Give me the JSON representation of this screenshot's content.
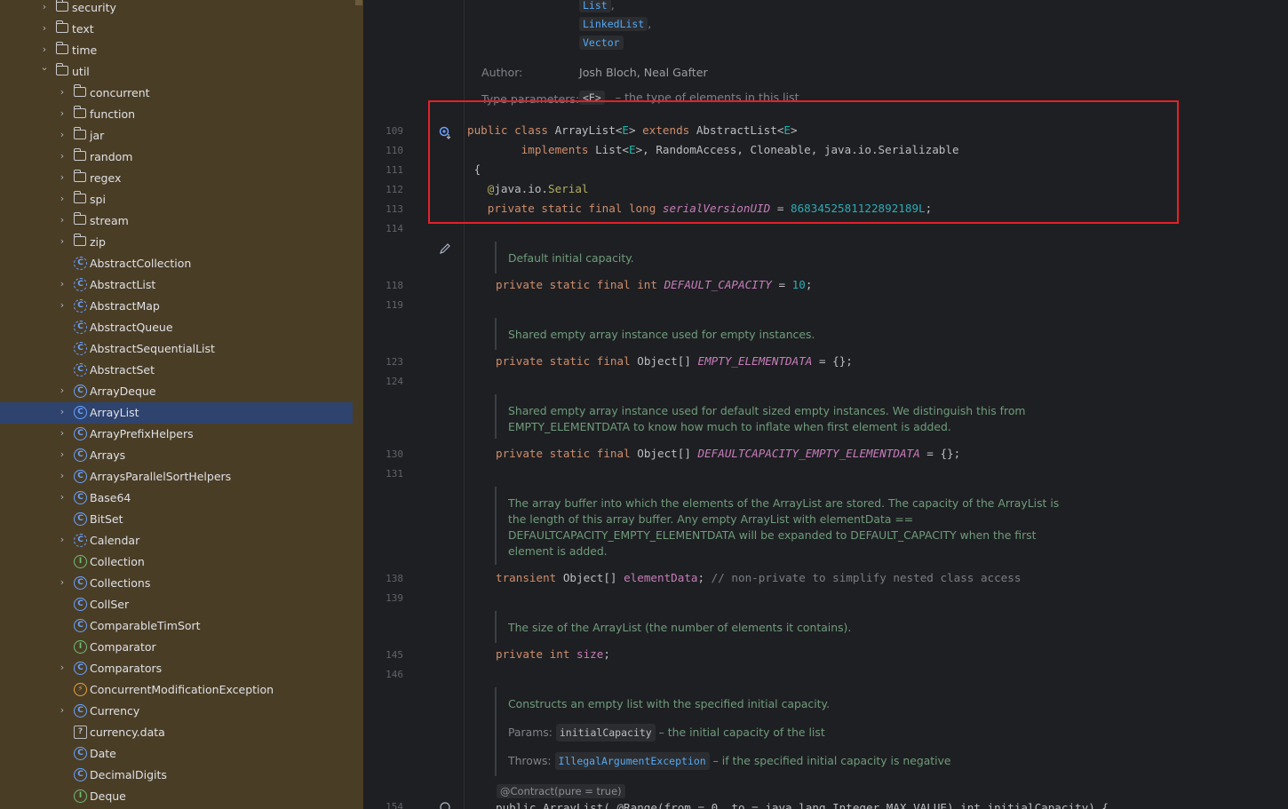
{
  "tree": {
    "items": [
      {
        "kind": "folder",
        "label": "security",
        "indent": 0,
        "expand": "right"
      },
      {
        "kind": "folder",
        "label": "text",
        "indent": 0,
        "expand": "right"
      },
      {
        "kind": "folder",
        "label": "time",
        "indent": 0,
        "expand": "right"
      },
      {
        "kind": "folder",
        "label": "util",
        "indent": 0,
        "expand": "down"
      },
      {
        "kind": "folder",
        "label": "concurrent",
        "indent": 1,
        "expand": "right"
      },
      {
        "kind": "folder",
        "label": "function",
        "indent": 1,
        "expand": "right"
      },
      {
        "kind": "folder",
        "label": "jar",
        "indent": 1,
        "expand": "right"
      },
      {
        "kind": "folder",
        "label": "random",
        "indent": 1,
        "expand": "right"
      },
      {
        "kind": "folder",
        "label": "regex",
        "indent": 1,
        "expand": "right"
      },
      {
        "kind": "folder",
        "label": "spi",
        "indent": 1,
        "expand": "right"
      },
      {
        "kind": "folder",
        "label": "stream",
        "indent": 1,
        "expand": "right"
      },
      {
        "kind": "folder",
        "label": "zip",
        "indent": 1,
        "expand": "right"
      },
      {
        "kind": "abstract",
        "label": "AbstractCollection",
        "indent": 1,
        "expand": ""
      },
      {
        "kind": "abstract",
        "label": "AbstractList",
        "indent": 1,
        "expand": "right"
      },
      {
        "kind": "abstract",
        "label": "AbstractMap",
        "indent": 1,
        "expand": "right"
      },
      {
        "kind": "abstract",
        "label": "AbstractQueue",
        "indent": 1,
        "expand": ""
      },
      {
        "kind": "abstract",
        "label": "AbstractSequentialList",
        "indent": 1,
        "expand": ""
      },
      {
        "kind": "abstract",
        "label": "AbstractSet",
        "indent": 1,
        "expand": ""
      },
      {
        "kind": "class",
        "label": "ArrayDeque",
        "indent": 1,
        "expand": "right"
      },
      {
        "kind": "class",
        "label": "ArrayList",
        "indent": 1,
        "expand": "right",
        "selected": true
      },
      {
        "kind": "class",
        "label": "ArrayPrefixHelpers",
        "indent": 1,
        "expand": "right"
      },
      {
        "kind": "class",
        "label": "Arrays",
        "indent": 1,
        "expand": "right"
      },
      {
        "kind": "class",
        "label": "ArraysParallelSortHelpers",
        "indent": 1,
        "expand": "right"
      },
      {
        "kind": "class",
        "label": "Base64",
        "indent": 1,
        "expand": "right"
      },
      {
        "kind": "class",
        "label": "BitSet",
        "indent": 1,
        "expand": ""
      },
      {
        "kind": "abstract",
        "label": "Calendar",
        "indent": 1,
        "expand": "right"
      },
      {
        "kind": "interface",
        "label": "Collection",
        "indent": 1,
        "expand": ""
      },
      {
        "kind": "class",
        "label": "Collections",
        "indent": 1,
        "expand": "right"
      },
      {
        "kind": "class",
        "label": "CollSer",
        "indent": 1,
        "expand": ""
      },
      {
        "kind": "class",
        "label": "ComparableTimSort",
        "indent": 1,
        "expand": ""
      },
      {
        "kind": "interface",
        "label": "Comparator",
        "indent": 1,
        "expand": ""
      },
      {
        "kind": "class",
        "label": "Comparators",
        "indent": 1,
        "expand": "right"
      },
      {
        "kind": "exception",
        "label": "ConcurrentModificationException",
        "indent": 1,
        "expand": ""
      },
      {
        "kind": "class",
        "label": "Currency",
        "indent": 1,
        "expand": "right"
      },
      {
        "kind": "file",
        "label": "currency.data",
        "indent": 1,
        "expand": ""
      },
      {
        "kind": "class",
        "label": "Date",
        "indent": 1,
        "expand": ""
      },
      {
        "kind": "class",
        "label": "DecimalDigits",
        "indent": 1,
        "expand": ""
      },
      {
        "kind": "interface",
        "label": "Deque",
        "indent": 1,
        "expand": ""
      }
    ]
  },
  "editor": {
    "see_also": [
      "List",
      "LinkedList",
      "Vector"
    ],
    "author_label": "Author:",
    "author_value": "Josh Bloch, Neal Gafter",
    "type_params_label": "Type parameters:",
    "type_params_chip": "<E>",
    "type_params_text": "– the type of elements in this list",
    "line_numbers": [
      "109",
      "110",
      "111",
      "112",
      "113",
      "114",
      "118",
      "119",
      "123",
      "124",
      "130",
      "131",
      "138",
      "139",
      "145",
      "146",
      "154"
    ],
    "docs": {
      "d1": "Default initial capacity.",
      "d2": "Shared empty array instance used for empty instances.",
      "d3a": "Shared empty array instance used for default sized empty instances. We distinguish this from",
      "d3b": "EMPTY_ELEMENTDATA to know how much to inflate when first element is added.",
      "d4a": "The array buffer into which the elements of the ArrayList are stored. The capacity of the ArrayList is",
      "d4b": "the length of this array buffer. Any empty ArrayList with elementData ==",
      "d4c": "DEFAULTCAPACITY_EMPTY_ELEMENTDATA will be expanded to DEFAULT_CAPACITY when the first",
      "d4d": "element is added.",
      "d5": "The size of the ArrayList (the number of elements it contains).",
      "d6": "Constructs an empty list with the specified initial capacity.",
      "params_label": "Params:",
      "params_chip": "initialCapacity",
      "params_text": "– the initial capacity of the list",
      "throws_label": "Throws:",
      "throws_chip": "IllegalArgumentException",
      "throws_text": "– if the specified initial capacity is negative",
      "contract": "@Contract(pure = true)"
    },
    "code": {
      "serial_uid": "8683452581122892189L",
      "default_capacity": "10",
      "comment_138": "// non-private to simplify nested class access",
      "last_line": "public ArrayList( @Range(from = 0, to = java.lang.Integer.MAX_VALUE) int initialCapacity) {"
    }
  }
}
